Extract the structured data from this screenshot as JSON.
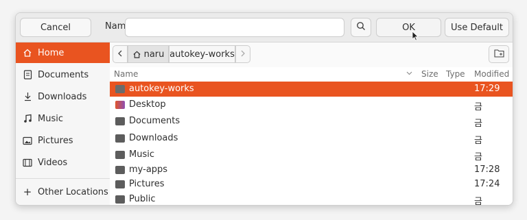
{
  "header": {
    "cancel_label": "Cancel",
    "name_label": "Name",
    "name_value": "",
    "ok_label": "OK",
    "default_label": "Use Default"
  },
  "sidebar": {
    "items": [
      {
        "label": "Home",
        "icon": "home-icon",
        "active": true
      },
      {
        "label": "Documents",
        "icon": "document-icon"
      },
      {
        "label": "Downloads",
        "icon": "download-icon"
      },
      {
        "label": "Music",
        "icon": "music-icon"
      },
      {
        "label": "Pictures",
        "icon": "picture-icon"
      },
      {
        "label": "Videos",
        "icon": "video-icon"
      }
    ],
    "other_locations": "Other Locations"
  },
  "pathbar": {
    "home": "naru",
    "current": "autokey-works"
  },
  "list": {
    "columns": {
      "name": "Name",
      "size": "Size",
      "type": "Type",
      "modified": "Modified"
    },
    "rows": [
      {
        "name": "autokey-works",
        "modified": "17:29",
        "selected": true
      },
      {
        "name": "Desktop",
        "modified": "금"
      },
      {
        "name": "Documents",
        "modified": "금"
      },
      {
        "name": "Downloads",
        "modified": "금"
      },
      {
        "name": "Music",
        "modified": "금"
      },
      {
        "name": "my-apps",
        "modified": "17:28"
      },
      {
        "name": "Pictures",
        "modified": "17:24"
      },
      {
        "name": "Public",
        "modified": "금"
      }
    ]
  },
  "colors": {
    "accent": "#e95420",
    "background": "#fafafa"
  }
}
